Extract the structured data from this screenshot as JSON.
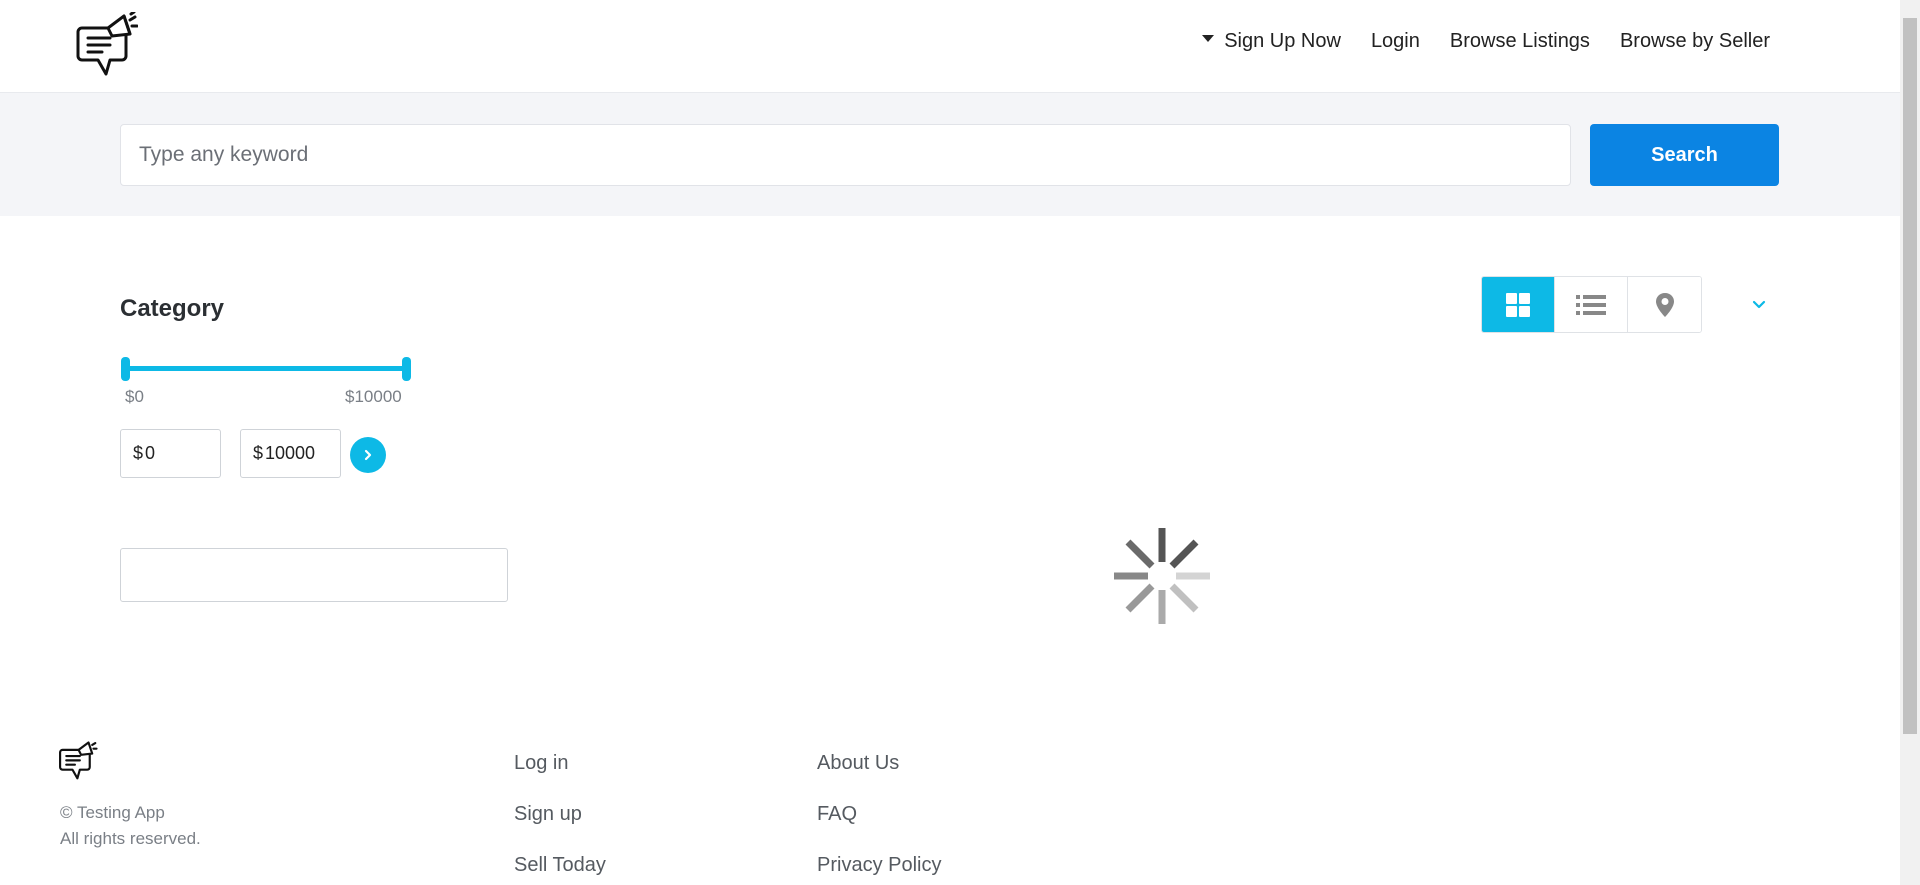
{
  "header": {
    "logo_icon": "megaphone-chat-icon",
    "nav": {
      "signup": "Sign Up Now",
      "login": "Login",
      "browse_listings": "Browse Listings",
      "browse_by_seller": "Browse by Seller"
    }
  },
  "search": {
    "placeholder": "Type any keyword",
    "value": "",
    "button_label": "Search"
  },
  "sidebar": {
    "category_title": "Category",
    "price_range": {
      "min_label": "$0",
      "max_label": "$10000",
      "currency": "$",
      "min_value": "0",
      "max_value": "10000",
      "slider_min_fraction": 0,
      "slider_max_fraction": 1
    },
    "go_icon": "chevron-right-icon"
  },
  "view_options": {
    "grid_icon": "grid-icon",
    "list_icon": "list-icon",
    "map_icon": "map-pin-icon",
    "active": "grid",
    "sort_icon": "chevron-down-icon"
  },
  "loading": {
    "icon": "loading-spinner-icon"
  },
  "footer": {
    "copyright_line1": "© Testing App",
    "copyright_line2": "All rights reserved.",
    "col1": [
      "Log in",
      "Sign up",
      "Sell Today"
    ],
    "col2": [
      "About Us",
      "FAQ",
      "Privacy Policy"
    ]
  },
  "colors": {
    "primary_button": "#0b84e3",
    "accent": "#0db9e6",
    "search_band_bg": "#f4f5f8"
  }
}
